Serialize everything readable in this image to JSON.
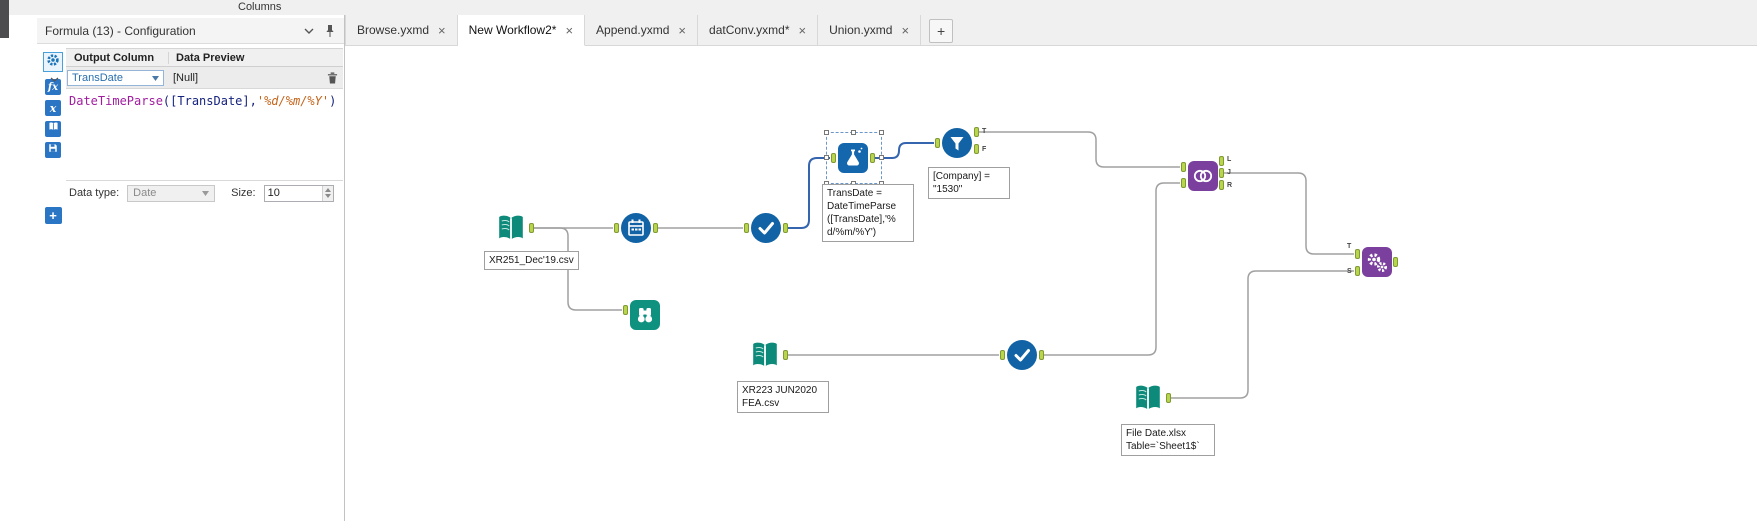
{
  "header": {
    "columns_label": "Columns"
  },
  "config_panel": {
    "title": "Formula (13) - Configuration",
    "side_icons": [
      "gear",
      "insert-function-fx",
      "insert-variable-x",
      "functions-book",
      "save-expression"
    ],
    "grid": {
      "col1": "Output Column",
      "col2": "Data Preview",
      "row": {
        "output_column": "TransDate",
        "data_preview": "[Null]"
      }
    },
    "expression": {
      "fn": "DateTimeParse",
      "mid": "([TransDate],",
      "str": "'%d/%m/%Y'",
      "end": ")"
    },
    "footer": {
      "data_type_label": "Data type:",
      "data_type_value": "Date",
      "size_label": "Size:",
      "size_value": "10"
    },
    "add_label": "+"
  },
  "tab_bar": {
    "tabs": [
      {
        "label": "Browse.yxmd",
        "active": false
      },
      {
        "label": "New Workflow2*",
        "active": true
      },
      {
        "label": "Append.yxmd",
        "active": false
      },
      {
        "label": "datConv.yxmd*",
        "active": false
      },
      {
        "label": "Union.yxmd",
        "active": false
      }
    ],
    "close_glyph": "×",
    "new_tab_glyph": "+"
  },
  "canvas": {
    "labels": {
      "input1": "XR251_Dec'19.csv",
      "input2_line1": "XR223 JUN2020",
      "input2_line2": "FEA.csv",
      "input3_line1": "File Date.xlsx",
      "input3_line2": "Table=`Sheet1$`"
    },
    "annotations": {
      "formula": {
        "lines": [
          "TransDate =",
          "DateTimeParse",
          "([TransDate],'%",
          "d/%m/%Y')"
        ]
      },
      "filter": {
        "lines": [
          "[Company] =",
          "\"1530\""
        ]
      }
    },
    "anchor_letters": {
      "filter_t": "T",
      "filter_f": "F",
      "join_l": "L",
      "join_j": "J",
      "join_r": "R",
      "append_t": "T",
      "append_s": "S"
    },
    "colors": {
      "tool_blue": "#1263a5",
      "tool_teal": "#0e8a7a",
      "tool_purple": "#7b3f9d",
      "anchor_green": "#b9d44d",
      "wire_gray": "#a0a0a0",
      "wire_selected": "#3565af",
      "selection_accent": "#49a1dc"
    }
  }
}
